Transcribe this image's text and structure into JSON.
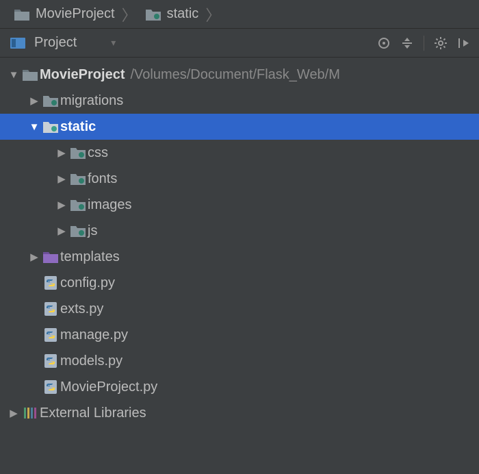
{
  "breadcrumb": {
    "root": "MovieProject",
    "child": "static"
  },
  "toolbar": {
    "view_label": "Project"
  },
  "tree": {
    "root": {
      "name": "MovieProject",
      "path": "/Volumes/Document/Flask_Web/M"
    },
    "children": {
      "migrations": "migrations",
      "static": "static",
      "css": "css",
      "fonts": "fonts",
      "images": "images",
      "js": "js",
      "templates": "templates",
      "config": "config.py",
      "exts": "exts.py",
      "manage": "manage.py",
      "models": "models.py",
      "movieproject": "MovieProject.py"
    },
    "external_libs": "External Libraries"
  }
}
